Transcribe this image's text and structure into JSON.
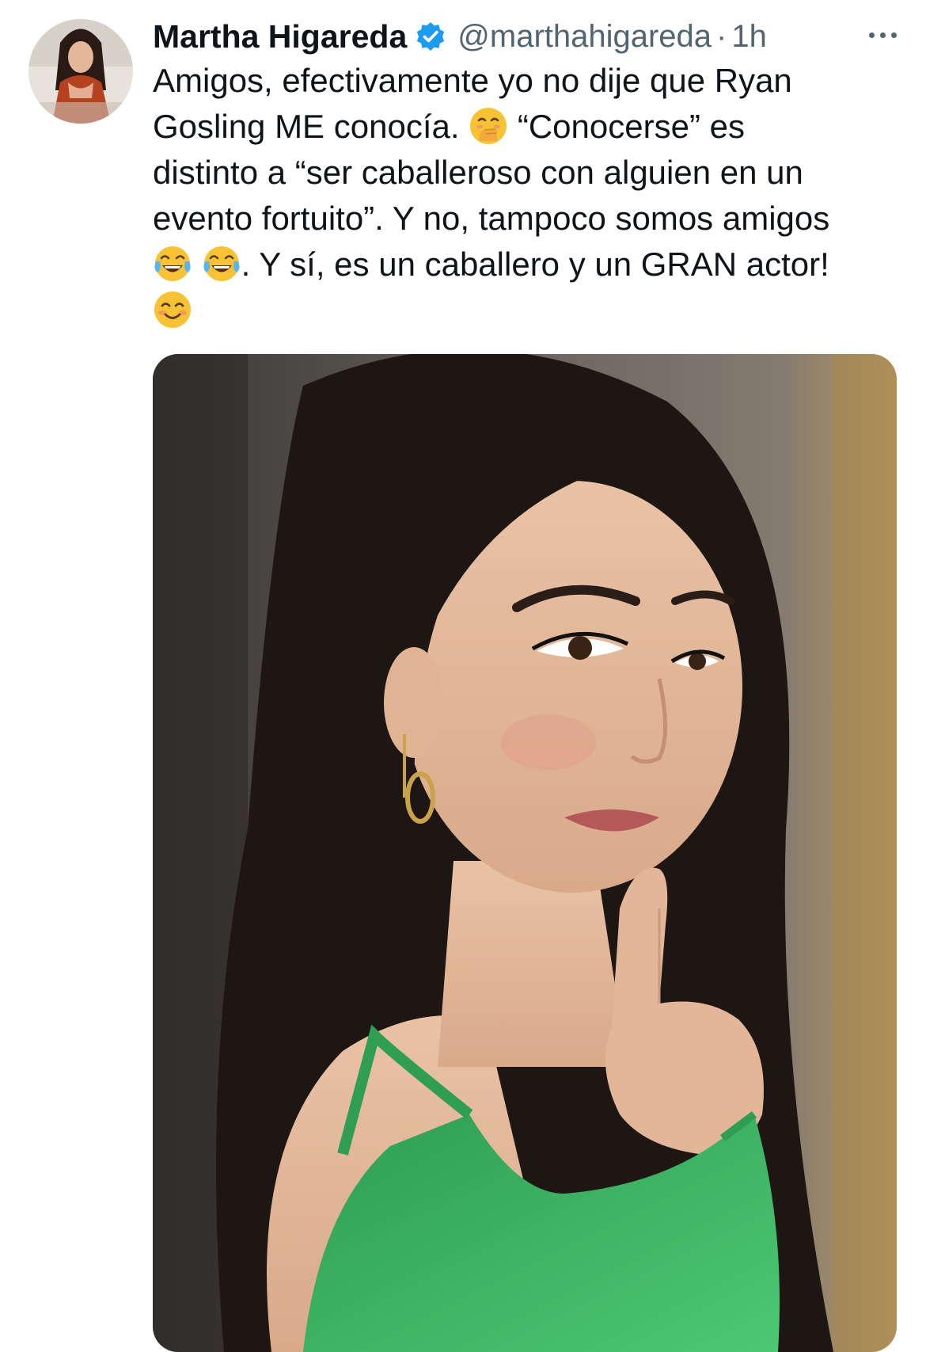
{
  "tweet": {
    "author": {
      "display_name": "Martha Higareda",
      "handle": "@marthahigareda",
      "verified": true,
      "avatar_icon": "profile-photo"
    },
    "separator": "·",
    "timestamp": "1h",
    "more_icon": "more-horizontal-icon",
    "text_lines": [
      "Amigos, efectivamente yo no dije que Ryan",
      "Gosling ME conocía.",
      "“Conocerse” es",
      "distinto a “ser caballeroso con alguien en un",
      "evento fortuito”. Y no, tampoco somos amigos",
      ". Y sí, es un caballero y un GRAN actor!"
    ],
    "emojis": [
      "face-with-hand-over-mouth",
      "face-with-tears-of-joy",
      "face-with-tears-of-joy",
      "smiling-face-with-smiling-eyes"
    ],
    "media": {
      "type": "photo",
      "icon": "photo-woman-green-dress"
    }
  },
  "colors": {
    "text_primary": "#0f1419",
    "text_secondary": "#536471",
    "verified_blue": "#1d9bf0",
    "dress_green": "#3cb564"
  }
}
